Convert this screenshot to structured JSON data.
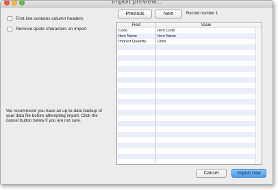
{
  "window": {
    "title": "Import preview..."
  },
  "options": {
    "first_line_headers": "First line contains column headers",
    "remove_quotes": "Remove quote characters on import"
  },
  "navigation": {
    "previous_label": "Previous",
    "next_label": "Next",
    "record_text": "Record number 1"
  },
  "table": {
    "columns": [
      "Field",
      "Value"
    ],
    "rows": [
      {
        "field": "Code",
        "value": "Item Code"
      },
      {
        "field": "Item Name",
        "value": "Item Name"
      },
      {
        "field": "Imprest Quantity",
        "value": "Units"
      },
      {
        "field": "",
        "value": ""
      },
      {
        "field": "",
        "value": ""
      },
      {
        "field": "",
        "value": ""
      },
      {
        "field": "",
        "value": ""
      },
      {
        "field": "",
        "value": ""
      },
      {
        "field": "",
        "value": ""
      },
      {
        "field": "",
        "value": ""
      },
      {
        "field": "",
        "value": ""
      },
      {
        "field": "",
        "value": ""
      },
      {
        "field": "",
        "value": ""
      },
      {
        "field": "",
        "value": ""
      },
      {
        "field": "",
        "value": ""
      },
      {
        "field": "",
        "value": ""
      },
      {
        "field": "",
        "value": ""
      },
      {
        "field": "",
        "value": ""
      },
      {
        "field": "",
        "value": ""
      },
      {
        "field": "",
        "value": ""
      },
      {
        "field": "",
        "value": ""
      },
      {
        "field": "",
        "value": ""
      },
      {
        "field": "",
        "value": ""
      },
      {
        "field": "",
        "value": ""
      },
      {
        "field": "",
        "value": ""
      }
    ]
  },
  "advice_text": "We recommend you have an up-to-date backup of your data file before attempting import. Click the cancel button below if you are not sure.",
  "actions": {
    "cancel_label": "Cancel",
    "import_label": "Import now"
  },
  "colors": {
    "primary_button": "#4a9bee",
    "row_stripe": "#e9eef9",
    "close": "#f25a4f",
    "minimize": "#f4bb3c",
    "maximize": "#63c246"
  }
}
